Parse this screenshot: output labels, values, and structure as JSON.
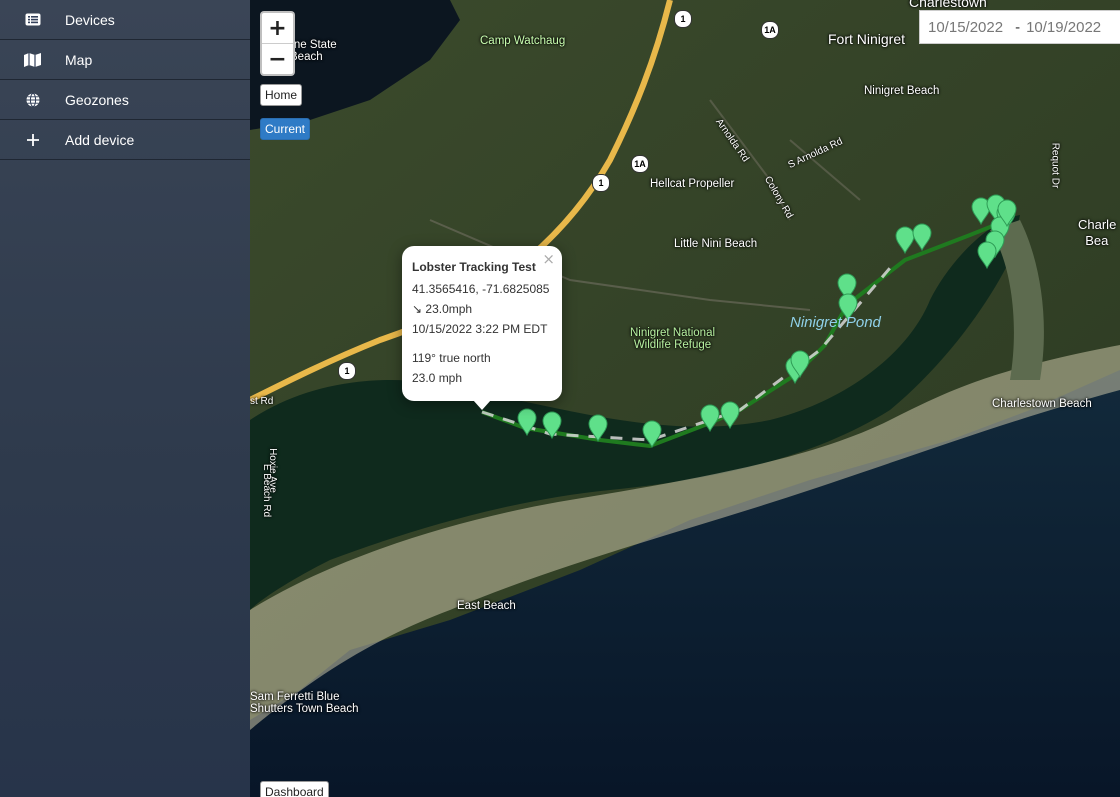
{
  "sidebar": {
    "items": [
      {
        "label": "Devices",
        "icon": "list-icon"
      },
      {
        "label": "Map",
        "icon": "map-icon"
      },
      {
        "label": "Geozones",
        "icon": "globe-icon"
      },
      {
        "label": "Add device",
        "icon": "plus-icon"
      }
    ]
  },
  "map": {
    "zoom_in": "+",
    "zoom_out": "−",
    "home_button": "Home",
    "current_button": "Current",
    "dashboard_button": "Dashboard",
    "date_from": "10/15/2022",
    "date_sep": "-",
    "date_to": "10/19/2022",
    "track_color": "#1f7a1f",
    "marker_color": "#5fe08a",
    "labels": {
      "charlestown": "Charlestown",
      "fort_ninigret": "Fort Ninigret",
      "ninigret_beach": "Ninigret Beach",
      "camp_watchaug": "Camp Watchaug",
      "state_beach": "rne State\nBeach",
      "hellcat": "Hellcat Propeller",
      "little_nini": "Little Nini Beach",
      "arnolda": "Arnolda Rd",
      "s_arnolda": "S Arnolda Rd",
      "colony": "Colony Rd",
      "ninigret_pond": "Ninigret Pond",
      "refuge": "Ninigret National\nWildlife Refuge",
      "charlestown_beach": "Charlestown Beach",
      "east_beach": "East Beach",
      "sam_ferretti": "Sam Ferretti Blue\nShutters Town Beach",
      "hoxie": "Hoxie Ave",
      "e_beach_rd": "E Beach Rd",
      "st_rd": "st Rd",
      "requot": "Requot Dr",
      "charle": "Charle\nBea"
    },
    "shields": [
      "1",
      "1",
      "1A",
      "1A",
      "1"
    ]
  },
  "popup": {
    "title": "Lobster Tracking Test",
    "coords": "41.3565416, -71.6825085",
    "speed_line": "↘ 23.0mph",
    "timestamp": "10/15/2022 3:22 PM EDT",
    "heading": "119° true north",
    "speed": "23.0 mph",
    "close": "×"
  }
}
